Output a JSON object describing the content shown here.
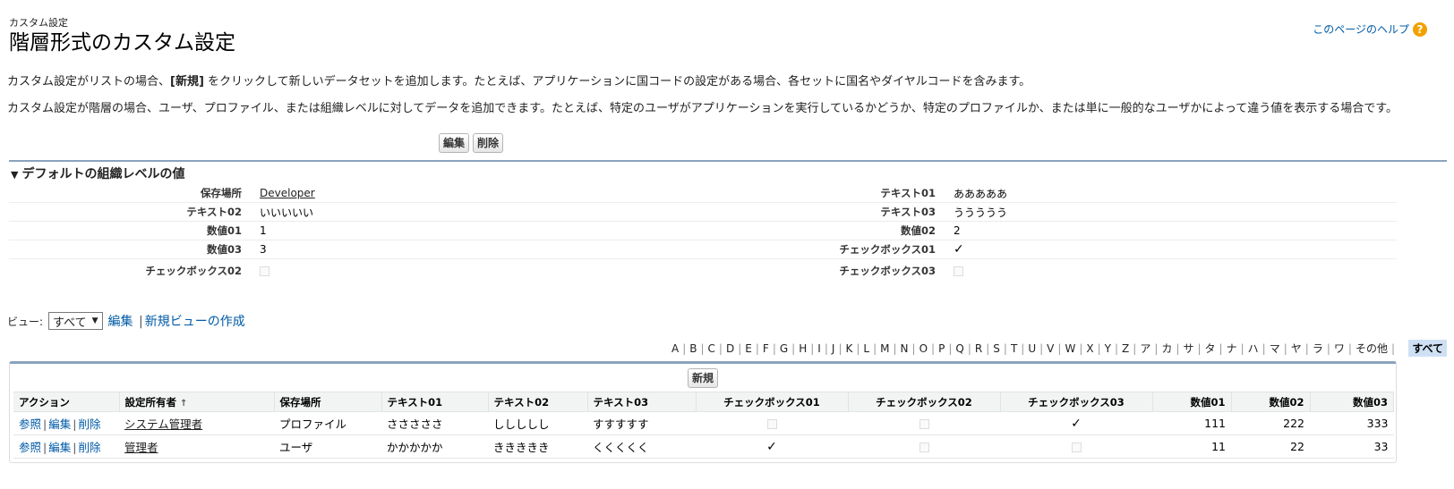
{
  "header": {
    "breadcrumb": "カスタム設定",
    "title": "階層形式のカスタム設定",
    "help_link": "このページのヘルプ",
    "help_icon": "?"
  },
  "description": {
    "line1_pre": "カスタム設定がリストの場合、",
    "line1_bold": "[新規]",
    "line1_post": " をクリックして新しいデータセットを追加します。たとえば、アプリケーションに国コードの設定がある場合、各セットに国名やダイヤルコードを含みます。",
    "line2": "カスタム設定が階層の場合、ユーザ、プロファイル、または組織レベルに対してデータを追加できます。たとえば、特定のユーザがアプリケーションを実行しているかどうか、特定のプロファイルか、または単に一般的なユーザかによって違う値を表示する場合です。"
  },
  "top_buttons": {
    "edit": "編集",
    "delete": "削除"
  },
  "default_section": {
    "title": "デフォルトの組織レベルの値",
    "rows": [
      {
        "l1": "保存場所",
        "v1": "Developer",
        "l2": "テキスト01",
        "v2": "あああああ"
      },
      {
        "l1": "テキスト02",
        "v1": "いいいいい",
        "l2": "テキスト03",
        "v2": "ううううう"
      },
      {
        "l1": "数値01",
        "v1": "1",
        "l2": "数値02",
        "v2": "2"
      },
      {
        "l1": "数値03",
        "v1": "3",
        "l2": "チェックボックス01",
        "v2": "✓"
      },
      {
        "l1": "チェックボックス02",
        "v1": "",
        "l2": "チェックボックス03",
        "v2": ""
      }
    ]
  },
  "view": {
    "label": "ビュー:",
    "selected": "すべて",
    "arrow": "▼",
    "edit_link": "編集",
    "separator": "|",
    "new_view_link": "新規ビューの作成"
  },
  "alpha_filter": {
    "letters": [
      "A",
      "B",
      "C",
      "D",
      "E",
      "F",
      "G",
      "H",
      "I",
      "J",
      "K",
      "L",
      "M",
      "N",
      "O",
      "P",
      "Q",
      "R",
      "S",
      "T",
      "U",
      "V",
      "W",
      "X",
      "Y",
      "Z",
      "ア",
      "カ",
      "サ",
      "タ",
      "ナ",
      "ハ",
      "マ",
      "ヤ",
      "ラ",
      "ワ",
      "その他"
    ],
    "active": "すべて"
  },
  "list": {
    "new_button": "新規",
    "columns": [
      "アクション",
      "設定所有者",
      "保存場所",
      "テキスト01",
      "テキスト02",
      "テキスト03",
      "チェックボックス01",
      "チェックボックス02",
      "チェックボックス03",
      "数値01",
      "数値02",
      "数値03"
    ],
    "sort_indicator": "↑",
    "action_labels": {
      "view": "参照",
      "edit": "編集",
      "delete": "削除"
    },
    "rows": [
      {
        "owner": "システム管理者",
        "location": "プロファイル",
        "t1": "さささささ",
        "t2": "ししししし",
        "t3": "すすすすす",
        "cb1": "",
        "cb2": "",
        "cb3": "✓",
        "n1": "111",
        "n2": "222",
        "n3": "333"
      },
      {
        "owner": "管理者",
        "location": "ユーザ",
        "t1": "かかかかか",
        "t2": "ききききき",
        "t3": "くくくくく",
        "cb1": "✓",
        "cb2": "",
        "cb3": "",
        "n1": "11",
        "n2": "22",
        "n3": "33"
      }
    ]
  },
  "colors": {
    "link": "#015ba7",
    "rule": "#8aa2bd",
    "help_icon": "#f2a100",
    "active_filter": "#cfe0f5"
  }
}
